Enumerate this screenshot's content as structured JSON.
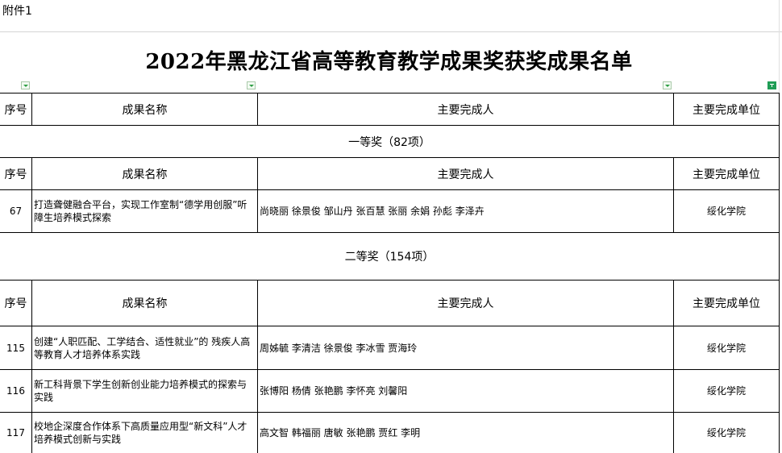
{
  "attachment_label": "附件1",
  "title": "2022年黑龙江省高等教育教学成果奖获奖成果名单",
  "headers": {
    "index": "序号",
    "name": "成果名称",
    "people": "主要完成人",
    "unit": "主要完成单位"
  },
  "sections": [
    {
      "title": "一等奖（82项）",
      "rows": [
        {
          "index": "67",
          "name": "打造聋健融合平台，实现工作室制“德学用创服”听障生培养模式探索",
          "people": "尚晓丽 徐景俊 邹山丹 张百慧 张丽 余娟 孙彪 李泽卉",
          "unit": "绥化学院"
        }
      ]
    },
    {
      "title": "二等奖（154项）",
      "rows": [
        {
          "index": "115",
          "name": "创建“人职匹配、工学结合、适性就业”的 残疾人高等教育人才培养体系实践",
          "people": "周姊毓 李清洁 徐景俊 李冰雪 贾海玲",
          "unit": "绥化学院"
        },
        {
          "index": "116",
          "name": "新工科背景下学生创新创业能力培养模式的探索与实践",
          "people": "张博阳 杨倩 张艳鹏 李怀亮 刘馨阳",
          "unit": "绥化学院"
        },
        {
          "index": "117",
          "name": "校地企深度合作体系下高质量应用型“新文科”人才培养模式创新与实践",
          "people": "高文智 韩福丽 唐敏 张艳鹏 贾红 李明",
          "unit": "绥化学院"
        }
      ]
    }
  ]
}
